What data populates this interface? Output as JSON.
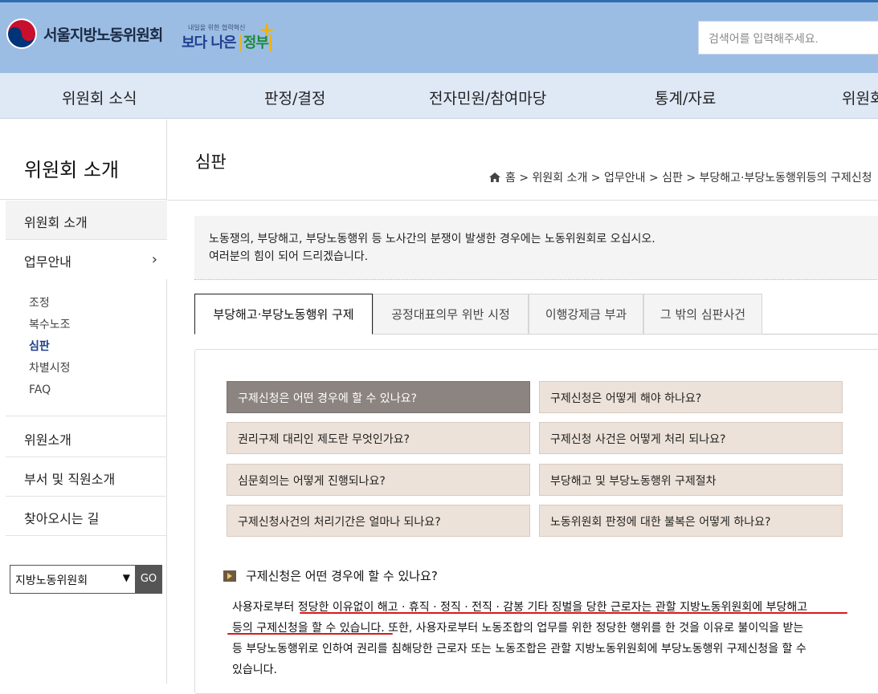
{
  "header": {
    "org_name": "서울지방노동위원회",
    "slogan_small": "내일을 위한 협력혁신",
    "slogan_big_1": "보다 나은",
    "slogan_big_2": "정부",
    "search_placeholder": "검색어를 입력해주세요."
  },
  "nav": {
    "items": [
      "위원회 소식",
      "판정/결정",
      "전자민원/참여마당",
      "통계/자료",
      "위원회"
    ]
  },
  "sidebar": {
    "title": "위원회 소개",
    "items": [
      "위원회 소개",
      "업무안내",
      "위원소개",
      "부서 및 직원소개",
      "찾아오시는 길"
    ],
    "chevron": "›",
    "sub_items": [
      "조정",
      "복수노조",
      "심판",
      "차별시정",
      "FAQ"
    ],
    "select_value": "지방노동위원회",
    "go_label": "GO"
  },
  "main": {
    "title": "심판",
    "breadcrumb": "홈 > 위원회 소개 > 업무안내 > 심판 > 부당해고·부당노동행위등의 구제신청",
    "intro_line1": "노동쟁의, 부당해고, 부당노동행위 등 노사간의 분쟁이 발생한 경우에는 노동위원회로 오십시오.",
    "intro_line2": "여러분의 힘이 되어 드리겠습니다.",
    "tabs": [
      "부당해고·부당노동행위 구제",
      "공정대표의무 위반 시정",
      "이행강제금 부과",
      "그 밖의 심판사건"
    ],
    "faq": [
      "구제신청은 어떤 경우에 할 수 있나요?",
      "구제신청은 어떻게 해야 하나요?",
      "권리구제 대리인 제도란 무엇인가요?",
      "구제신청 사건은 어떻게 처리 되나요?",
      "심문회의는 어떻게 진행되나요?",
      "부당해고 및 부당노동행위 구제절차",
      "구제신청사건의 처리기간은 얼마나 되나요?",
      "노동위원회 판정에 대한 불복은 어떻게 하나요?"
    ],
    "section_title": "구제신청은 어떤 경우에 할 수 있나요?",
    "body_line1": "사용자로부터 정당한 이유없이 해고 · 휴직 · 정직 · 전직 · 감봉 기타 징벌을 당한 근로자는 관할 지방노동위원회에 부당해고",
    "body_line2": "등의 구제신청을 할 수 있습니다. 또한, 사용자로부터 노동조합의 업무를 위한 정당한 행위를 한 것을 이유로 불이익을 받는",
    "body_line3": "등 부당노동행위로 인하여 권리를 침해당한 근로자 또는 노동조합은 관할 지방노동위원회에 부당노동행위 구제신청을 할 수",
    "body_line4": "있습니다."
  },
  "colors": {
    "header_bg": "#9cbde3",
    "nav_bg": "#dfe8f5",
    "faq_bg": "#ece2d9",
    "faq_active_bg": "#8c8480",
    "underline": "#d7191c"
  }
}
